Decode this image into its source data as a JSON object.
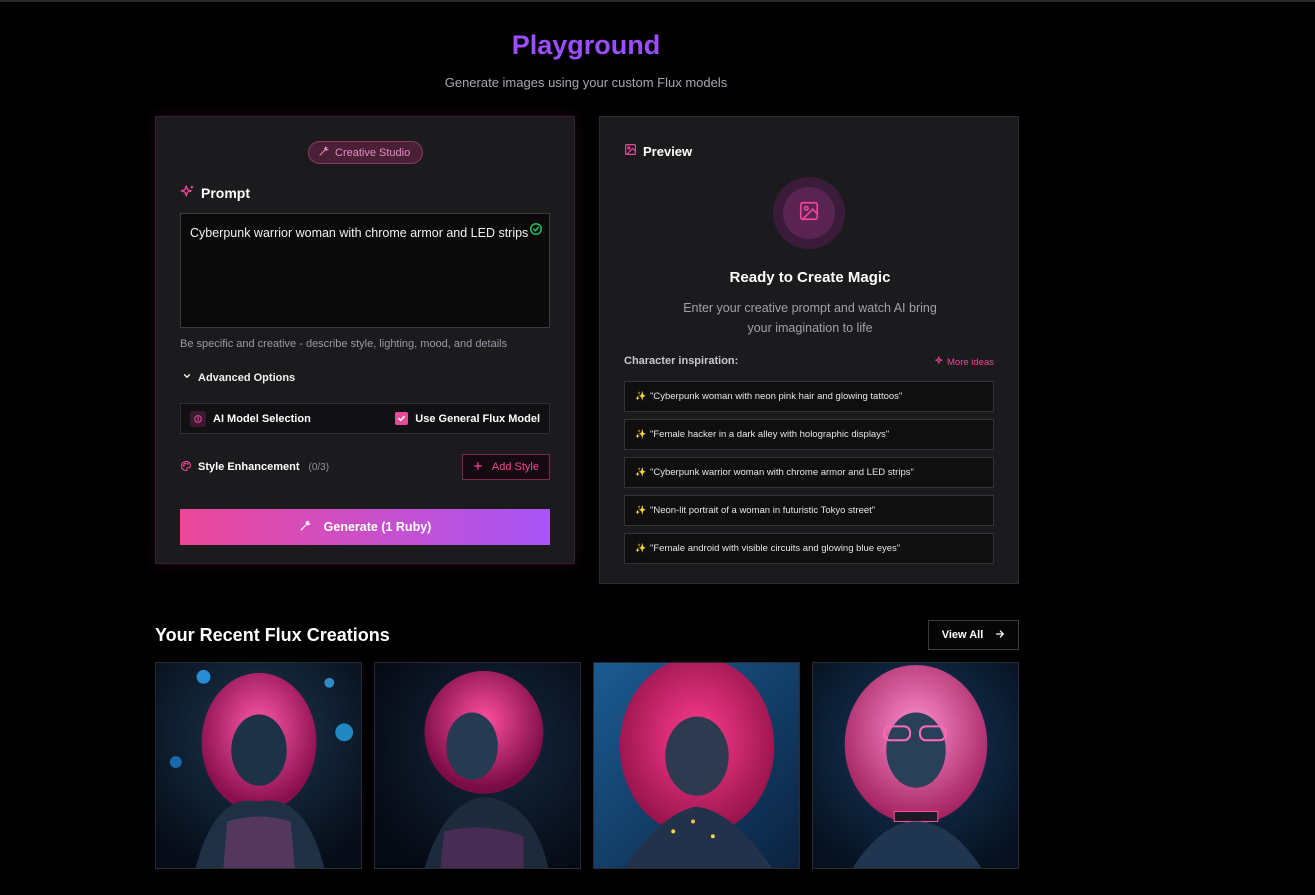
{
  "header": {
    "title": "Playground",
    "subtitle": "Generate images using your custom Flux models"
  },
  "left_panel": {
    "badge": "Creative Studio",
    "prompt_label": "Prompt",
    "prompt_value": "Cyberpunk warrior woman with chrome armor and LED strips",
    "hint": "Be specific and creative - describe style, lighting, mood, and details",
    "advanced_label": "Advanced Options",
    "model_selection_label": "AI Model Selection",
    "general_model_label": "Use General Flux Model",
    "general_model_checked": true,
    "style_label": "Style Enhancement",
    "style_count": "(0/3)",
    "add_style_label": "Add Style",
    "generate_label": "Generate (1 Ruby)"
  },
  "preview": {
    "title": "Preview",
    "ready_title": "Ready to Create Magic",
    "ready_subtitle": "Enter your creative prompt and watch AI bring your imagination to life",
    "inspiration_label": "Character inspiration:",
    "more_ideas_label": "More ideas",
    "inspirations": [
      "\"Cyberpunk woman with neon pink hair and glowing tattoos\"",
      "\"Female hacker in a dark alley with holographic displays\"",
      "\"Cyberpunk warrior woman with chrome armor and LED strips\"",
      "\"Neon-lit portrait of a woman in futuristic Tokyo street\"",
      "\"Female android with visible circuits and glowing blue eyes\""
    ]
  },
  "recent": {
    "title": "Your Recent Flux Creations",
    "view_all_label": "View All"
  },
  "colors": {
    "accent_pink": "#ec4899",
    "accent_purple": "#a855f7",
    "title_purple": "#9b4dff"
  },
  "icons": {
    "badge": "wand-icon",
    "prompt": "sparkles-icon",
    "preview": "image-icon",
    "model": "cpu-icon",
    "style": "palette-icon",
    "add": "plus-icon",
    "view_all": "arrow-right-icon"
  }
}
